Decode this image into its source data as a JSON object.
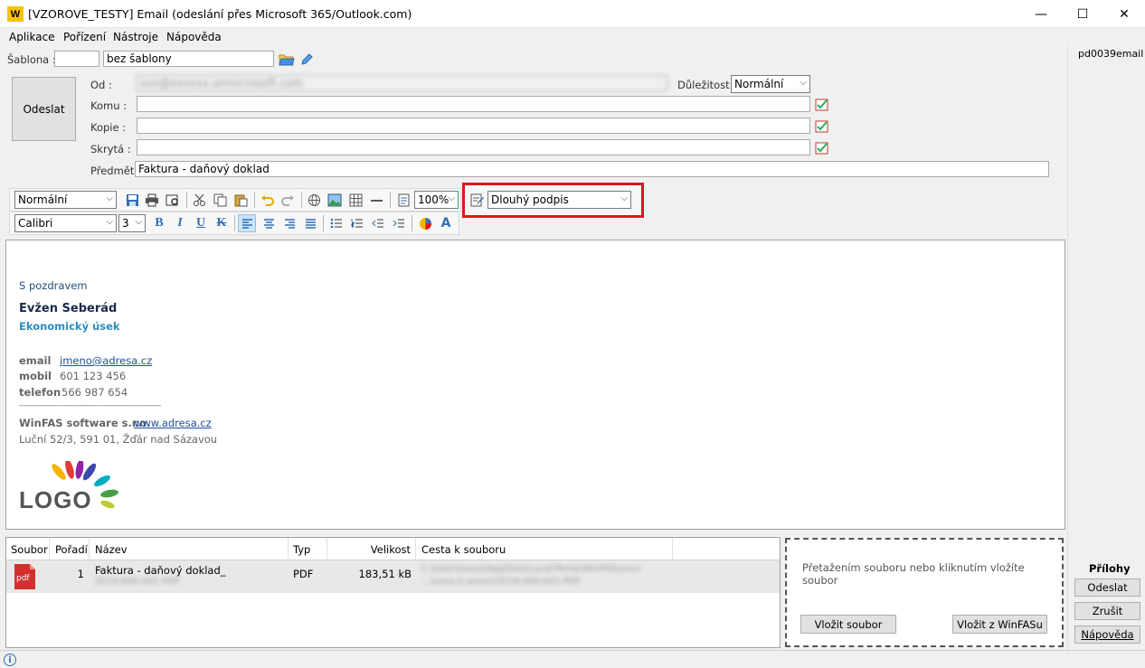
{
  "window": {
    "logo_text": "W",
    "title": "[VZOROVE_TESTY] Email (odeslání přes Microsoft 365/Outlook.com)",
    "minimize": "—",
    "maximize": "☐",
    "close": "✕"
  },
  "menu": {
    "items": [
      {
        "label": "Aplikace"
      },
      {
        "label": "Pořízení"
      },
      {
        "label": "Nástroje"
      },
      {
        "label": "Nápověda"
      }
    ]
  },
  "template": {
    "label": "Šablona :",
    "code": "",
    "name": "bez šablony"
  },
  "send_button": "Odeslat",
  "fields": {
    "from_label": "Od :",
    "from_value": "xxx@xxxxxx.onmicrosoft.com",
    "to_label": "Komu :",
    "to_value": "",
    "cc_label": "Kopie :",
    "cc_value": "",
    "bcc_label": "Skrytá :",
    "bcc_value": "",
    "subject_label": "Předmět :",
    "subject_value": "Faktura - daňový doklad",
    "importance_label": "Důležitost :",
    "importance_value": "Normální"
  },
  "toolbar": {
    "style": "Normální",
    "zoom": "100%",
    "signature": "Dlouhý podpis",
    "font": "Calibri",
    "size": "3"
  },
  "signature": {
    "greeting": "S pozdravem",
    "name": "Evžen Seberád",
    "department": "Ekonomický úsek",
    "email_label": "email",
    "email_value": "jmeno@adresa.cz",
    "mobile_label": "mobil",
    "mobile_value": "601 123 456",
    "phone_label": "telefon",
    "phone_value": "566 987 654",
    "divider": "---------------------------------------------------------",
    "company": "WinFAS software s.r.o.",
    "website": "www.adresa.cz",
    "address": "Luční 52/3, 591 01, Žďár nad Sázavou",
    "logo_text": "LOGO"
  },
  "attachments": {
    "columns": [
      "Soubor",
      "Pořadí",
      "Název",
      "Typ",
      "Velikost",
      "Cesta k souboru"
    ],
    "rows": [
      {
        "icon": "pdf",
        "order": "1",
        "name": "Faktura - daňový doklad_",
        "name_sub": "2019-000-001-PDF",
        "type": "PDF",
        "size": "183,51 kB",
        "path": "C:\\Users\\xxxx\\AppData\\Local\\Temp\\WinFAS\\xxxx",
        "path_sub": "...\\xxxx-x-xxxxx\\2019-000-001-PDF"
      }
    ]
  },
  "dropzone": {
    "hint": "Přetažením souboru nebo kliknutím vložíte soubor",
    "insert_file": "Vložit soubor",
    "insert_winfas": "Vložit z WinFASu"
  },
  "right_panel": {
    "code": "pd0039email",
    "attachments_title": "Přílohy",
    "send": "Odeslat",
    "cancel": "Zrušit",
    "help": "Nápověda"
  },
  "status": {
    "info_icon": "i"
  }
}
